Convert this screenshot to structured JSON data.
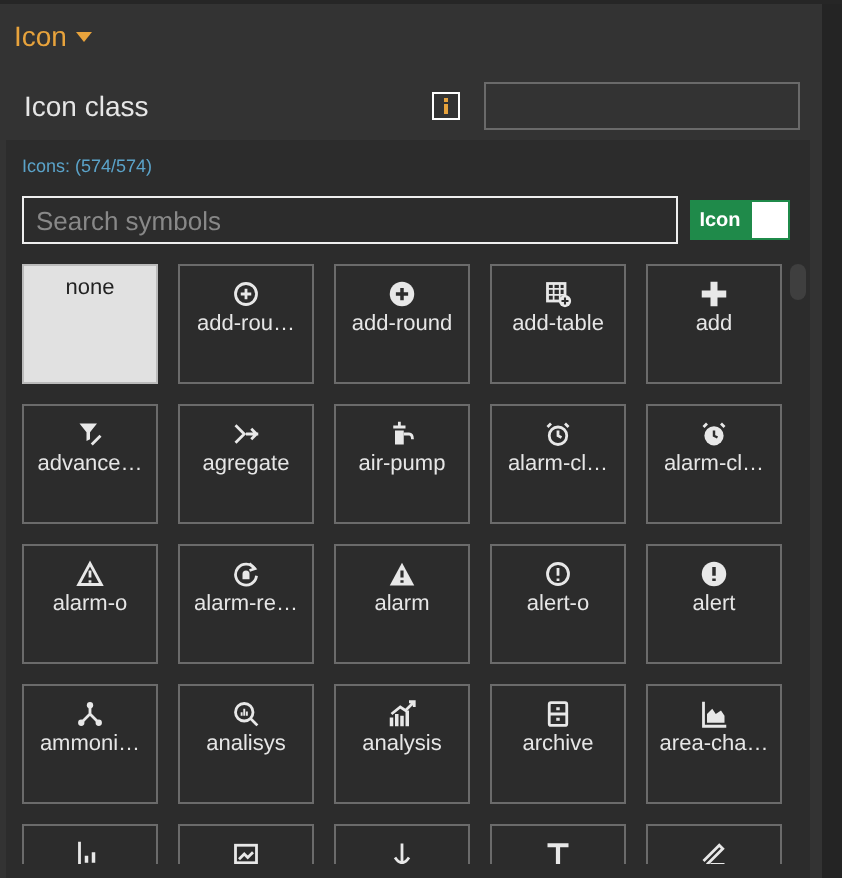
{
  "section": {
    "title": "Icon",
    "expanded": true
  },
  "field": {
    "label": "Icon class"
  },
  "picker": {
    "count": "Icons: (574/574)",
    "search": {
      "placeholder": "Search symbols"
    },
    "toggle": {
      "label": "Icon",
      "on": true
    },
    "tiles": [
      {
        "label": "none",
        "selected": true
      },
      {
        "label": "add-rou…",
        "selected": false
      },
      {
        "label": "add-round",
        "selected": false
      },
      {
        "label": "add-table",
        "selected": false
      },
      {
        "label": "add",
        "selected": false
      },
      {
        "label": "advance…",
        "selected": false
      },
      {
        "label": "agregate",
        "selected": false
      },
      {
        "label": "air-pump",
        "selected": false
      },
      {
        "label": "alarm-cl…",
        "selected": false
      },
      {
        "label": "alarm-cl…",
        "selected": false
      },
      {
        "label": "alarm-o",
        "selected": false
      },
      {
        "label": "alarm-re…",
        "selected": false
      },
      {
        "label": "alarm",
        "selected": false
      },
      {
        "label": "alert-o",
        "selected": false
      },
      {
        "label": "alert",
        "selected": false
      },
      {
        "label": "ammoni…",
        "selected": false
      },
      {
        "label": "analisys",
        "selected": false
      },
      {
        "label": "analysis",
        "selected": false
      },
      {
        "label": "archive",
        "selected": false
      },
      {
        "label": "area-cha…",
        "selected": false
      },
      {
        "selected": false
      },
      {
        "selected": false
      },
      {
        "selected": false
      },
      {
        "selected": false
      },
      {
        "selected": false
      }
    ]
  }
}
